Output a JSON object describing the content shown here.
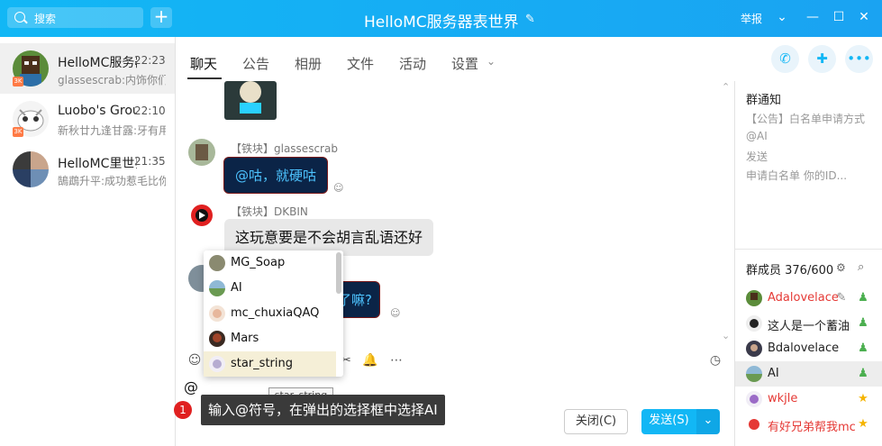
{
  "window": {
    "title": "HelloMC服务器表世界",
    "report": "举报"
  },
  "search": {
    "placeholder": "搜索"
  },
  "conversations": [
    {
      "name": "HelloMC服务器表世界",
      "time": "22:23",
      "preview": "glassescrab:内饰你们都不行",
      "selected": true
    },
    {
      "name": "Luobo's Group",
      "time": "22:10",
      "preview": "新秋廿九逢甘露:牙有用吗",
      "selected": false
    },
    {
      "name": "HelloMC里世界",
      "time": "21:35",
      "preview": "鵠鵡升平:成功惹毛比你",
      "selected": false
    }
  ],
  "tabs": [
    "聊天",
    "公告",
    "相册",
    "文件",
    "活动",
    "设置"
  ],
  "messages": [
    {
      "sender": "【铁块】glassescrab",
      "text": "@咕，就硬咕"
    },
    {
      "sender": "【铁块】DKBIN",
      "text": "这玩意要是不会胡言乱语还好"
    },
    {
      "text": "了嘛?"
    }
  ],
  "mention_popup": {
    "items": [
      "MG_Soap",
      "AI",
      "mc_chuxiaQAQ",
      "Mars",
      "star_string"
    ],
    "selected": "star_string"
  },
  "input": {
    "text": "@",
    "tooltip": "star_string"
  },
  "buttons": {
    "close": "关闭(C)",
    "send": "发送(S)"
  },
  "hint": {
    "number": "1",
    "text": "输入@符号，在弹出的选择框中选择AI"
  },
  "notice": {
    "title": "群通知",
    "lines": [
      "【公告】白名单申请方式",
      "@AI",
      "发送",
      "申请白名单 你的ID..."
    ]
  },
  "members": {
    "header": "群成员 376/600",
    "list": [
      {
        "name": "Adalovelace",
        "red": true,
        "role": "edit"
      },
      {
        "name": "这人是一个蓄油",
        "red": false,
        "role": "admin"
      },
      {
        "name": "Bdalovelace",
        "red": false,
        "role": "admin"
      },
      {
        "name": "AI",
        "red": false,
        "role": "admin",
        "selected": true
      },
      {
        "name": "wkjle",
        "red": true,
        "role": "star"
      },
      {
        "name": "有好兄弟帮我mc",
        "red": true,
        "role": "star"
      }
    ]
  },
  "colors": {
    "accent": "#12b7f5",
    "hint_bg": "#3a3a3a",
    "bubble_dark": "#0b2447"
  }
}
